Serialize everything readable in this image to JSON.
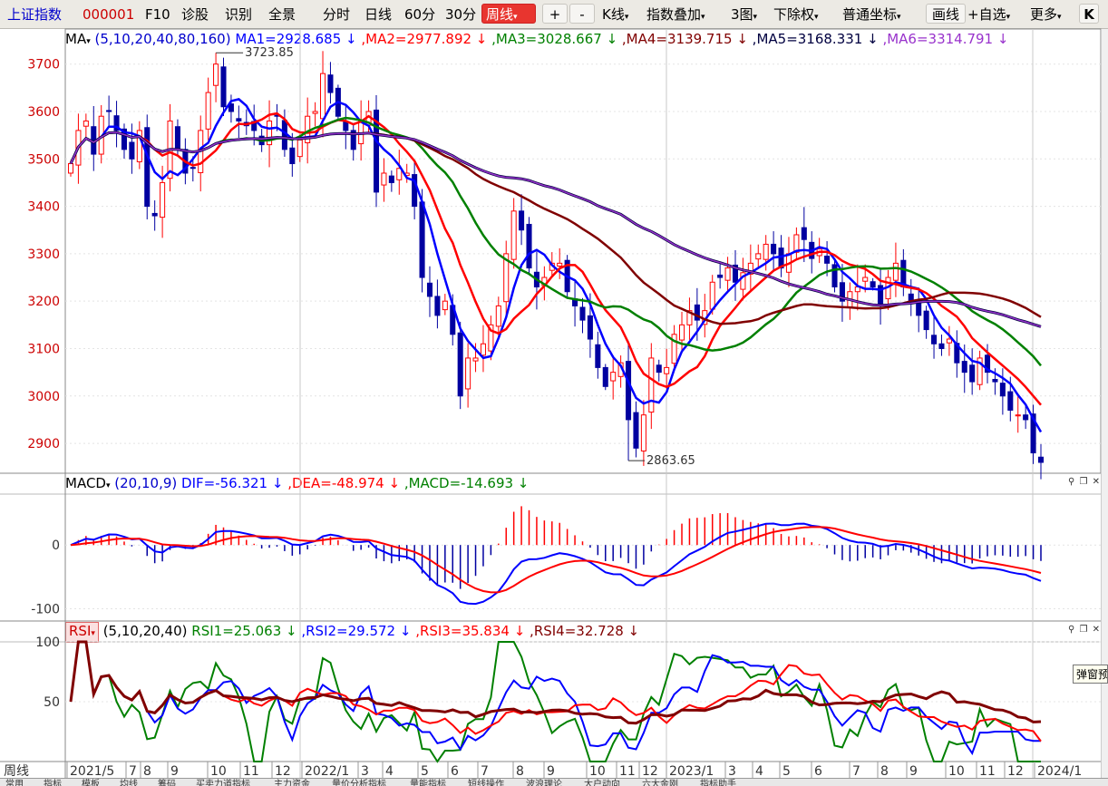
{
  "toolbar": {
    "index_name": "上证指数",
    "index_code": "000001",
    "items": [
      "F10",
      "诊股",
      "识别",
      "全景"
    ],
    "period_buttons": [
      "分时",
      "日线",
      "60分",
      "30分"
    ],
    "active_period": "周线",
    "plus": "+",
    "minus": "-",
    "menus": [
      "K线",
      "指数叠加",
      "3图",
      "下除权",
      "普通坐标"
    ],
    "draw_button": "画线",
    "watchlist_button": "+自选",
    "more_button": "更多",
    "k_button": "K"
  },
  "ma_panel": {
    "indicator": "MA",
    "params": "(5,10,20,40,80,160)",
    "legend": [
      {
        "text": "MA1=2928.685",
        "arrow": "↓",
        "color": "#0000ff"
      },
      {
        "text": "MA2=2977.892",
        "arrow": "↓",
        "color": "#ff0000"
      },
      {
        "text": "MA3=3028.667",
        "arrow": "↓",
        "color": "#008000"
      },
      {
        "text": "MA4=3139.715",
        "arrow": "↓",
        "color": "#800000"
      },
      {
        "text": "MA5=3168.331",
        "arrow": "↓",
        "color": "#000040"
      },
      {
        "text": "MA6=3314.791",
        "arrow": "↓",
        "color": "#9933cc"
      }
    ],
    "yticks": [
      "3700",
      "3600",
      "3500",
      "3400",
      "3300",
      "3200",
      "3100",
      "3000",
      "2900"
    ],
    "high_label": "3723.85",
    "low_label": "2863.65"
  },
  "macd_panel": {
    "indicator": "MACD",
    "params": "(20,10,9)",
    "legend": [
      {
        "text": "DIF=-56.321",
        "arrow": "↓",
        "color": "#0000ff"
      },
      {
        "text": "DEA=-48.974",
        "arrow": "↓",
        "color": "#ff0000"
      },
      {
        "text": "MACD=-14.693",
        "arrow": "↓",
        "color": "#008000"
      }
    ],
    "yticks": [
      "0",
      "-100"
    ]
  },
  "rsi_panel": {
    "indicator": "RSI",
    "params": "(5,10,20,40)",
    "legend": [
      {
        "text": "RSI1=25.063",
        "arrow": "↓",
        "color": "#008000"
      },
      {
        "text": "RSI2=29.572",
        "arrow": "↓",
        "color": "#0000ff"
      },
      {
        "text": "RSI3=35.834",
        "arrow": "↓",
        "color": "#ff0000"
      },
      {
        "text": "RSI4=32.728",
        "arrow": "↓",
        "color": "#800000"
      }
    ],
    "yticks": [
      "100",
      "50",
      "0"
    ]
  },
  "xaxis": {
    "period_label": "周线",
    "labels": [
      "2021/5",
      "7",
      "8",
      "9",
      "10",
      "11",
      "12",
      "2022/1",
      "3",
      "4",
      "5",
      "6",
      "7",
      "8",
      "9",
      "10",
      "11",
      "12",
      "2023/1",
      "3",
      "4",
      "5",
      "6",
      "7",
      "8",
      "9",
      "10",
      "11",
      "12",
      "2024/1"
    ]
  },
  "tooltip": "弹窗预",
  "bottom_tabs": [
    "常用",
    "指标",
    "模板",
    "均线",
    "筹码",
    "买卖力道指标",
    "主力资金",
    "量价分析指标",
    "量能指标",
    "短线操作",
    "波浪理论",
    "大户动向",
    "六大金刚",
    "指标助手"
  ],
  "colors": {
    "up": "#ff0000",
    "down": "#0000a0",
    "ma1": "#0000ff",
    "ma2": "#ff0000",
    "ma3": "#008000",
    "ma4": "#800000",
    "ma5": "#000040",
    "ma6": "#9933cc"
  },
  "chart_data": {
    "type": "candlestick",
    "period": "weekly",
    "range_start": "2021/5",
    "range_end": "2024/1",
    "price_ylim": [
      2860,
      3730
    ],
    "highest": 3723.85,
    "lowest": 2863.65,
    "closes": [
      3490,
      3560,
      3580,
      3510,
      3590,
      3600,
      3560,
      3520,
      3500,
      3560,
      3400,
      3380,
      3450,
      3580,
      3520,
      3470,
      3480,
      3560,
      3640,
      3700,
      3610,
      3600,
      3580,
      3570,
      3560,
      3530,
      3580,
      3590,
      3520,
      3490,
      3540,
      3590,
      3600,
      3680,
      3640,
      3590,
      3560,
      3520,
      3580,
      3600,
      3430,
      3470,
      3450,
      3480,
      3470,
      3400,
      3250,
      3210,
      3170,
      3200,
      3130,
      3000,
      3080,
      3080,
      3110,
      3150,
      3190,
      3300,
      3390,
      3350,
      3270,
      3230,
      3250,
      3280,
      3280,
      3220,
      3190,
      3160,
      3120,
      3060,
      3020,
      3050,
      3070,
      2950,
      2890,
      2960,
      3080,
      3050,
      3060,
      3130,
      3150,
      3180,
      3160,
      3180,
      3240,
      3250,
      3270,
      3240,
      3260,
      3280,
      3300,
      3320,
      3300,
      3270,
      3300,
      3340,
      3330,
      3290,
      3310,
      3280,
      3230,
      3200,
      3220,
      3230,
      3250,
      3230,
      3190,
      3250,
      3280,
      3230,
      3200,
      3170,
      3140,
      3110,
      3100,
      3120,
      3070,
      3050,
      3030,
      3080,
      3050,
      3030,
      3000,
      2970,
      2960,
      2950,
      2880,
      2860
    ],
    "ma_last": {
      "MA5": 2928.685,
      "MA10": 2977.892,
      "MA20": 3028.667,
      "MA40": 3139.715,
      "MA80": 3168.331,
      "MA160": 3314.791
    },
    "macd_last": {
      "DIF": -56.321,
      "DEA": -48.974,
      "MACD": -14.693
    },
    "macd_ylim": [
      -115,
      80
    ],
    "rsi_last": {
      "RSI5": 25.063,
      "RSI10": 29.572,
      "RSI20": 35.834,
      "RSI40": 32.728
    },
    "rsi_ylim": [
      0,
      100
    ]
  }
}
